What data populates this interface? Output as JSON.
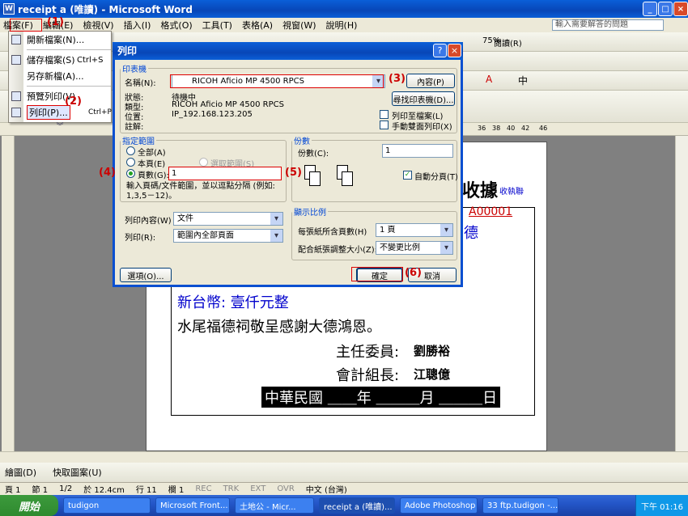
{
  "window": {
    "title": "receipt a (唯讀) - Microsoft Word"
  },
  "menubar": {
    "items": [
      "檔案(F)",
      "編輯(E)",
      "檢視(V)",
      "插入(I)",
      "格式(O)",
      "工具(T)",
      "表格(A)",
      "視窗(W)",
      "說明(H)"
    ],
    "help_placeholder": "輸入需要解答的問題"
  },
  "toolbar": {
    "zoom": "75%",
    "read_label": "閱讀(R)"
  },
  "file_menu": {
    "items": [
      {
        "label": "開新檔案(N)..."
      },
      {
        "label": "儲存檔案(S)",
        "shortcut": "Ctrl+S"
      },
      {
        "label": "另存新檔(A)..."
      },
      {
        "label": "預覽列印(V)"
      },
      {
        "label": "列印(P)...",
        "shortcut": "Ctrl+P"
      }
    ]
  },
  "annotations": {
    "a1": "(1)",
    "a2": "(2)",
    "a3": "(3)",
    "a4": "(4)",
    "a5": "(5)",
    "a6": "(6)"
  },
  "print_dialog": {
    "title": "列印",
    "printer_group": "印表機",
    "name_label": "名稱(N):",
    "printer_name": "RICOH Aficio MP 4500 RPCS",
    "properties_button": "內容(P)",
    "find_printer_button": "尋找印表機(D)...",
    "status_label": "狀態:",
    "status_value": "待機中",
    "type_label": "類型:",
    "type_value": "RICOH Aficio MP 4500 RPCS",
    "where_label": "位置:",
    "where_value": "IP_192.168.123.205",
    "comment_label": "註解:",
    "print_to_file": "列印至檔案(L)",
    "manual_duplex": "手動雙面列印(X)",
    "range_group": "指定範圍",
    "range_all": "全部(A)",
    "range_current": "本頁(E)",
    "range_selection": "選取範圍(S)",
    "range_pages": "頁數(G):",
    "pages_value": "1",
    "range_hint": "輸入頁碼/文件範圍，並以逗點分隔 (例如: 1,3,5－12)。",
    "copies_group": "份數",
    "copies_label": "份數(C):",
    "copies_value": "1",
    "collate": "自動分頁(T)",
    "print_what_label": "列印內容(W)",
    "print_what_value": "文件",
    "print_label": "列印(R):",
    "print_value": "範圍內全部頁面",
    "zoom_group": "顯示比例",
    "pages_per_sheet_label": "每張紙所含頁數(H)",
    "pages_per_sheet_value": "1 頁",
    "scale_label": "配合紙張調整大小(Z):",
    "scale_value": "不變更比例",
    "options_button": "選項(O)...",
    "ok_button": "確定",
    "cancel_button": "取消"
  },
  "ruler": {
    "ticks": [
      "36",
      "38",
      "40",
      "42",
      "46"
    ]
  },
  "document": {
    "title": "收據",
    "title_small": "收執聯",
    "number": "A00001",
    "line_de": "德",
    "amount": "新台幣: 壹仟元整",
    "thanks": "水尾福德祠敬呈感謝大德鴻恩。",
    "chair_label": "主任委員:",
    "chair_name": "劉勝裕",
    "acct_label": "會計組長:",
    "acct_name": "江聰億",
    "date_line": "中華民國 ＿＿年 ＿＿＿月 ＿＿＿日"
  },
  "drawbar": {
    "draw_label": "繪圖(D)",
    "autoshape_label": "快取圖案(U)"
  },
  "statusbar": {
    "page": "頁 1",
    "section": "節 1",
    "pages": "1/2",
    "at": "於 12.4cm",
    "line": "行 11",
    "col": "欄 1",
    "rec": "REC",
    "trk": "TRK",
    "ext": "EXT",
    "ovr": "OVR",
    "lang": "中文 (台灣)"
  },
  "taskbar": {
    "start": "開始",
    "tasks": [
      "tudigon",
      "Microsoft Front...",
      "土地公 - Micr...",
      "receipt a (唯讀)...",
      "Adobe Photoshop",
      "33 ftp.tudigon -..."
    ],
    "clock": "下午 01:16"
  }
}
